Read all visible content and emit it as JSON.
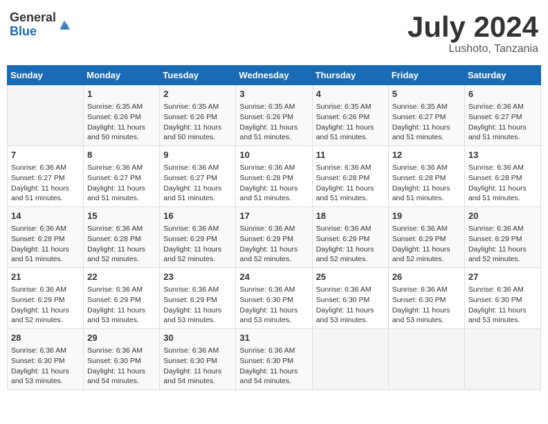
{
  "header": {
    "logo_general": "General",
    "logo_blue": "Blue",
    "month": "July 2024",
    "location": "Lushoto, Tanzania"
  },
  "weekdays": [
    "Sunday",
    "Monday",
    "Tuesday",
    "Wednesday",
    "Thursday",
    "Friday",
    "Saturday"
  ],
  "weeks": [
    [
      {
        "day": null,
        "info": ""
      },
      {
        "day": "1",
        "info": "Sunrise: 6:35 AM\nSunset: 6:26 PM\nDaylight: 11 hours\nand 50 minutes."
      },
      {
        "day": "2",
        "info": "Sunrise: 6:35 AM\nSunset: 6:26 PM\nDaylight: 11 hours\nand 50 minutes."
      },
      {
        "day": "3",
        "info": "Sunrise: 6:35 AM\nSunset: 6:26 PM\nDaylight: 11 hours\nand 51 minutes."
      },
      {
        "day": "4",
        "info": "Sunrise: 6:35 AM\nSunset: 6:26 PM\nDaylight: 11 hours\nand 51 minutes."
      },
      {
        "day": "5",
        "info": "Sunrise: 6:35 AM\nSunset: 6:27 PM\nDaylight: 11 hours\nand 51 minutes."
      },
      {
        "day": "6",
        "info": "Sunrise: 6:36 AM\nSunset: 6:27 PM\nDaylight: 11 hours\nand 51 minutes."
      }
    ],
    [
      {
        "day": "7",
        "info": "Sunrise: 6:36 AM\nSunset: 6:27 PM\nDaylight: 11 hours\nand 51 minutes."
      },
      {
        "day": "8",
        "info": "Sunrise: 6:36 AM\nSunset: 6:27 PM\nDaylight: 11 hours\nand 51 minutes."
      },
      {
        "day": "9",
        "info": "Sunrise: 6:36 AM\nSunset: 6:27 PM\nDaylight: 11 hours\nand 51 minutes."
      },
      {
        "day": "10",
        "info": "Sunrise: 6:36 AM\nSunset: 6:28 PM\nDaylight: 11 hours\nand 51 minutes."
      },
      {
        "day": "11",
        "info": "Sunrise: 6:36 AM\nSunset: 6:28 PM\nDaylight: 11 hours\nand 51 minutes."
      },
      {
        "day": "12",
        "info": "Sunrise: 6:36 AM\nSunset: 6:28 PM\nDaylight: 11 hours\nand 51 minutes."
      },
      {
        "day": "13",
        "info": "Sunrise: 6:36 AM\nSunset: 6:28 PM\nDaylight: 11 hours\nand 51 minutes."
      }
    ],
    [
      {
        "day": "14",
        "info": "Sunrise: 6:36 AM\nSunset: 6:28 PM\nDaylight: 11 hours\nand 51 minutes."
      },
      {
        "day": "15",
        "info": "Sunrise: 6:36 AM\nSunset: 6:28 PM\nDaylight: 11 hours\nand 52 minutes."
      },
      {
        "day": "16",
        "info": "Sunrise: 6:36 AM\nSunset: 6:29 PM\nDaylight: 11 hours\nand 52 minutes."
      },
      {
        "day": "17",
        "info": "Sunrise: 6:36 AM\nSunset: 6:29 PM\nDaylight: 11 hours\nand 52 minutes."
      },
      {
        "day": "18",
        "info": "Sunrise: 6:36 AM\nSunset: 6:29 PM\nDaylight: 11 hours\nand 52 minutes."
      },
      {
        "day": "19",
        "info": "Sunrise: 6:36 AM\nSunset: 6:29 PM\nDaylight: 11 hours\nand 52 minutes."
      },
      {
        "day": "20",
        "info": "Sunrise: 6:36 AM\nSunset: 6:29 PM\nDaylight: 11 hours\nand 52 minutes."
      }
    ],
    [
      {
        "day": "21",
        "info": "Sunrise: 6:36 AM\nSunset: 6:29 PM\nDaylight: 11 hours\nand 52 minutes."
      },
      {
        "day": "22",
        "info": "Sunrise: 6:36 AM\nSunset: 6:29 PM\nDaylight: 11 hours\nand 53 minutes."
      },
      {
        "day": "23",
        "info": "Sunrise: 6:36 AM\nSunset: 6:29 PM\nDaylight: 11 hours\nand 53 minutes."
      },
      {
        "day": "24",
        "info": "Sunrise: 6:36 AM\nSunset: 6:30 PM\nDaylight: 11 hours\nand 53 minutes."
      },
      {
        "day": "25",
        "info": "Sunrise: 6:36 AM\nSunset: 6:30 PM\nDaylight: 11 hours\nand 53 minutes."
      },
      {
        "day": "26",
        "info": "Sunrise: 6:36 AM\nSunset: 6:30 PM\nDaylight: 11 hours\nand 53 minutes."
      },
      {
        "day": "27",
        "info": "Sunrise: 6:36 AM\nSunset: 6:30 PM\nDaylight: 11 hours\nand 53 minutes."
      }
    ],
    [
      {
        "day": "28",
        "info": "Sunrise: 6:36 AM\nSunset: 6:30 PM\nDaylight: 11 hours\nand 53 minutes."
      },
      {
        "day": "29",
        "info": "Sunrise: 6:36 AM\nSunset: 6:30 PM\nDaylight: 11 hours\nand 54 minutes."
      },
      {
        "day": "30",
        "info": "Sunrise: 6:36 AM\nSunset: 6:30 PM\nDaylight: 11 hours\nand 54 minutes."
      },
      {
        "day": "31",
        "info": "Sunrise: 6:36 AM\nSunset: 6:30 PM\nDaylight: 11 hours\nand 54 minutes."
      },
      {
        "day": null,
        "info": ""
      },
      {
        "day": null,
        "info": ""
      },
      {
        "day": null,
        "info": ""
      }
    ]
  ]
}
